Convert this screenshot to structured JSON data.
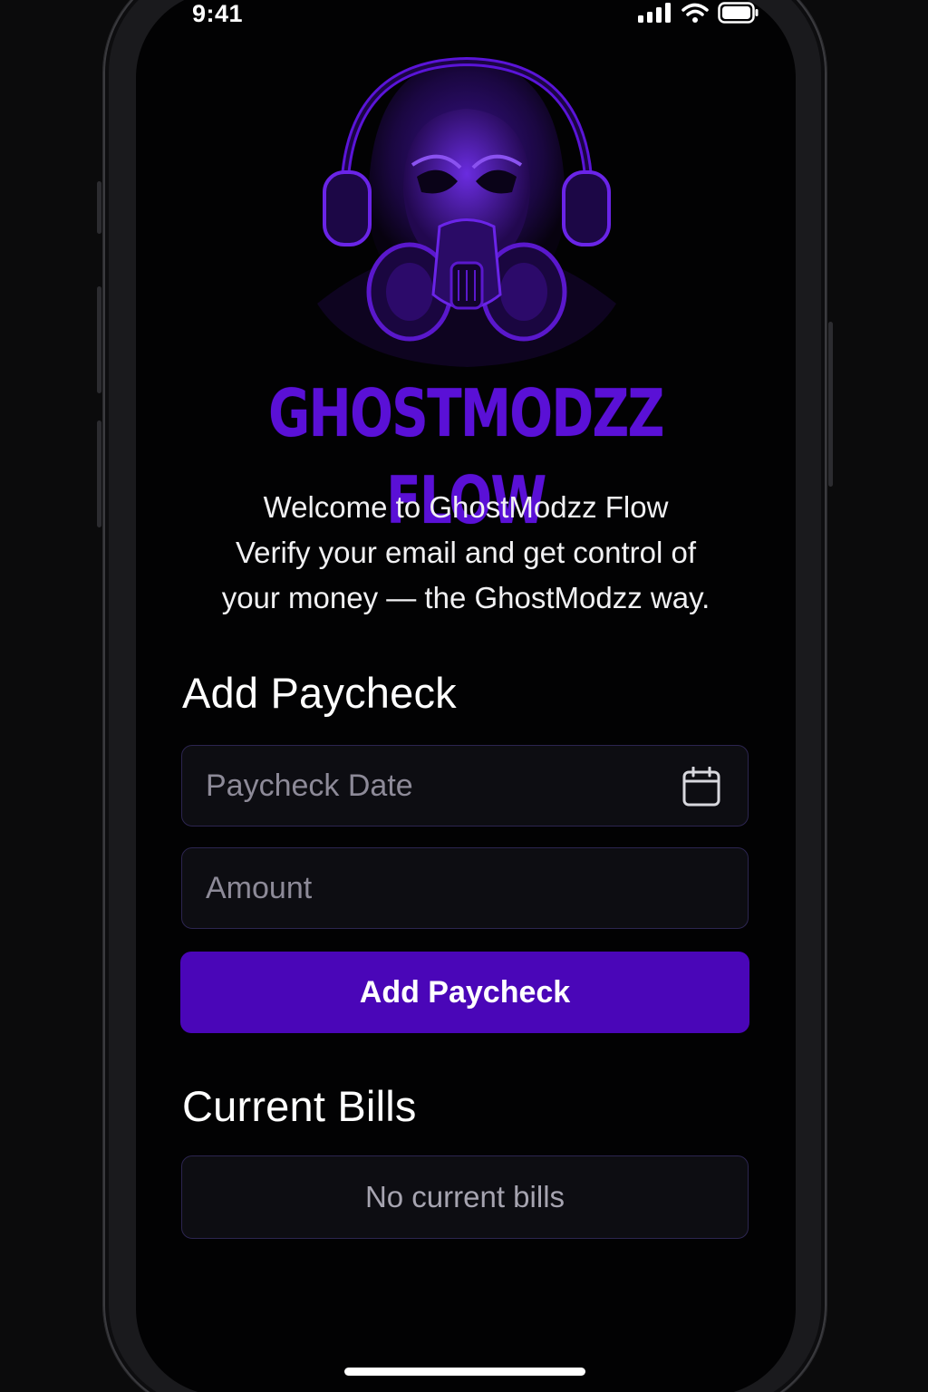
{
  "status_bar": {
    "time": "9:41",
    "icons": [
      "cellular-signal-icon",
      "wifi-icon",
      "battery-icon"
    ]
  },
  "branding": {
    "logo": "ghost-gas-mask-headphones-logo",
    "title": "GHOSTMODZZ FLOW",
    "accent_color": "#5a10d6"
  },
  "welcome": {
    "lines": [
      "Welcome to GhostModzz Flow",
      "Verify your email and get control of",
      "your money — the GhostModzz way."
    ]
  },
  "add_paycheck": {
    "heading": "Add Paycheck",
    "date_field": {
      "placeholder": "Paycheck Date",
      "value": "",
      "icon": "calendar-icon"
    },
    "amount_field": {
      "placeholder": "Amount",
      "value": ""
    },
    "submit_label": "Add Paycheck",
    "button_color": "#4a06b8"
  },
  "current_bills": {
    "heading": "Current Bills",
    "empty_text": "No current bills"
  }
}
